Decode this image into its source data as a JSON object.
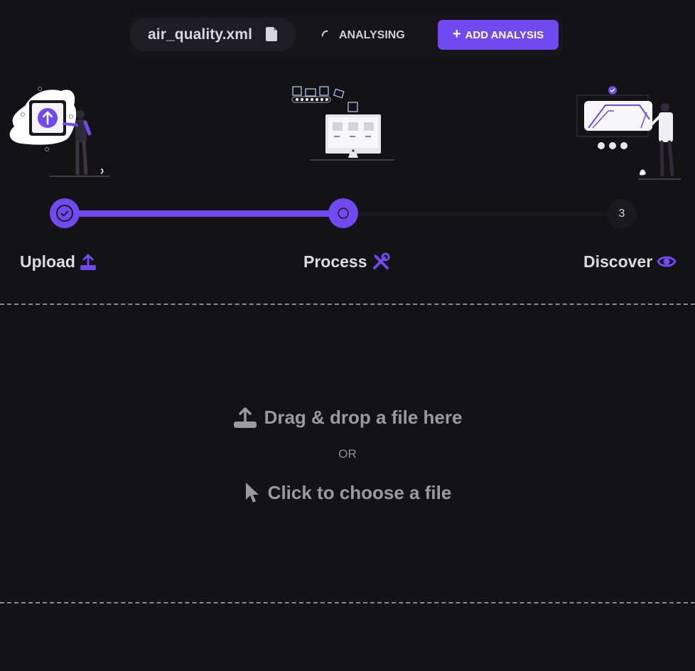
{
  "toolbar": {
    "file_name": "air_quality.xml",
    "file_icon": "file-icon",
    "status_label": "ANALYSING",
    "status_icon": "spinner-icon",
    "add_button_plus": "+",
    "add_button_label": "ADD ANALYSIS"
  },
  "stepper": {
    "current_step": 2,
    "steps": [
      {
        "number": "1",
        "label": "Upload",
        "icon": "upload-icon",
        "state": "completed"
      },
      {
        "number": "2",
        "label": "Process",
        "icon": "tools-icon",
        "state": "active"
      },
      {
        "number": "3",
        "label": "Discover",
        "icon": "eye-icon",
        "state": "pending"
      }
    ]
  },
  "dropzone": {
    "drag_text": "Drag & drop a file here",
    "or_text": "OR",
    "click_text": "Click to choose a file"
  },
  "colors": {
    "accent": "#7049f0",
    "background": "#131315",
    "muted_text": "#9a9a9f"
  }
}
